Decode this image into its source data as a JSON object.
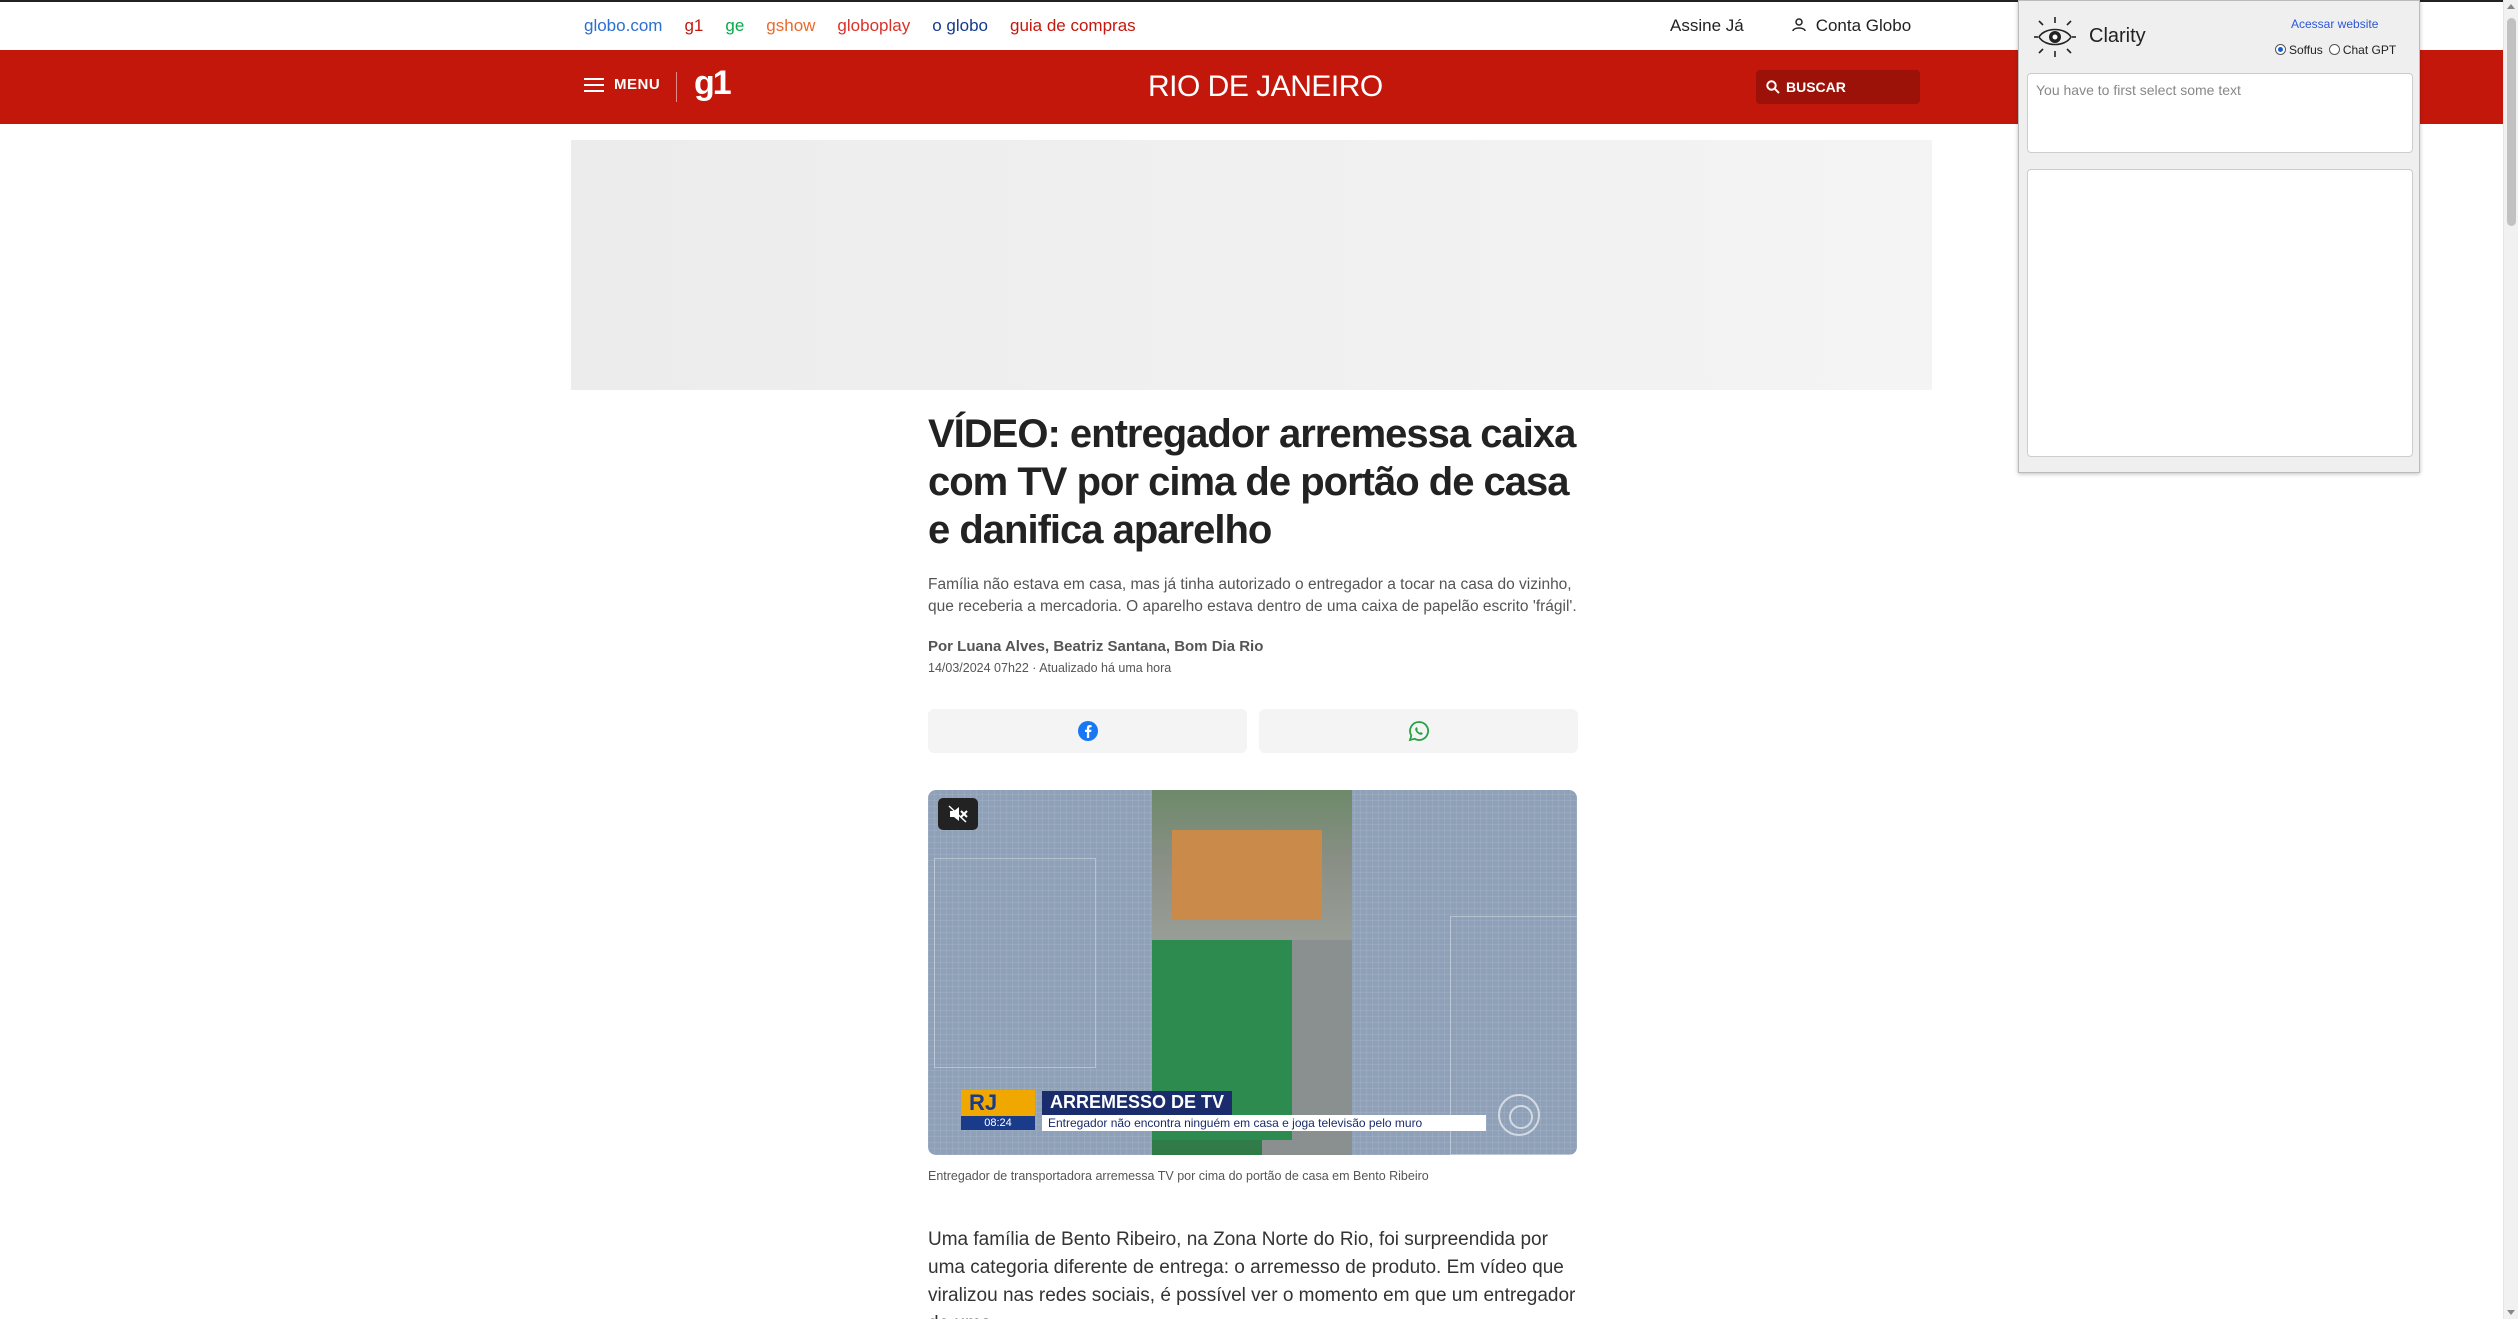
{
  "globo_bar": {
    "links": [
      {
        "label": "globo.com",
        "color": "#2b6fcf"
      },
      {
        "label": "g1",
        "color": "#c4170c"
      },
      {
        "label": "ge",
        "color": "#06aa48"
      },
      {
        "label": "gshow",
        "color": "#ea6a2e"
      },
      {
        "label": "globoplay",
        "color": "#d9322a"
      },
      {
        "label": "o globo",
        "color": "#143a8c"
      },
      {
        "label": "guia de compras",
        "color": "#c4170c"
      }
    ],
    "subscribe": "Assine Já",
    "account": "Conta Globo"
  },
  "header": {
    "menu_label": "MENU",
    "logo": "g1",
    "region": "RIO DE JANEIRO",
    "search_label": "BUSCAR",
    "brand_color": "#c4170c"
  },
  "article": {
    "title": "VÍDEO: entregador arremessa caixa com TV por cima de portão de casa e danifica aparelho",
    "subtitle": "Família não estava em casa, mas já tinha autorizado o entregador a tocar na casa do vizinho, que receberia a mercadoria. O aparelho estava dentro de uma caixa de papelão escrito 'frágil'.",
    "byline": "Por Luana Alves, Beatriz Santana, Bom Dia Rio",
    "dateline": "14/03/2024 07h22 · Atualizado há uma hora",
    "share": [
      {
        "icon": "facebook-icon",
        "color": "#1877f2"
      },
      {
        "icon": "whatsapp-icon",
        "color": "#25a244"
      }
    ],
    "video": {
      "badge": "RJ",
      "time": "08:24",
      "headline": "ARREMESSO DE TV",
      "subline": "Entregador não encontra ninguém em casa e joga televisão pelo muro",
      "mute_icon": "muted-speaker-icon"
    },
    "caption": "Entregador de transportadora arremessa TV por cima do portão de casa em Bento Ribeiro",
    "body": "Uma família de Bento Ribeiro, na Zona Norte do Rio, foi surpreendida por uma categoria diferente de entrega: o arremesso de produto. Em vídeo que viralizou nas redes sociais, é possível ver o momento em que um entregador de uma"
  },
  "clarity": {
    "name": "Clarity",
    "link": "Acessar website",
    "options": [
      {
        "label": "Soffus",
        "selected": true
      },
      {
        "label": "Chat GPT",
        "selected": false
      }
    ],
    "placeholder": "You have to first select some text"
  }
}
